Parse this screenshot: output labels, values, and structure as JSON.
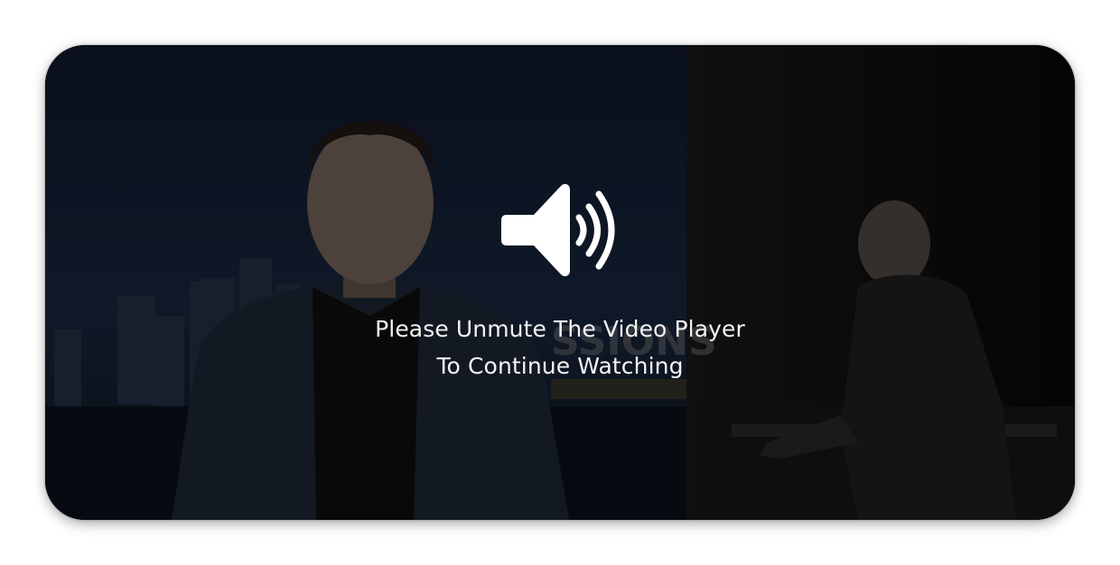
{
  "player": {
    "message": {
      "line1": "Please Unmute The Video Player",
      "line2": "To Continue Watching"
    },
    "watermark": "SSIONS",
    "icon": "speaker-volume-icon"
  },
  "colors": {
    "page_background": "#ffffff",
    "player_background": "#0b0f18",
    "prompt_text": "#f2f2f2",
    "icon": "#ffffff"
  }
}
